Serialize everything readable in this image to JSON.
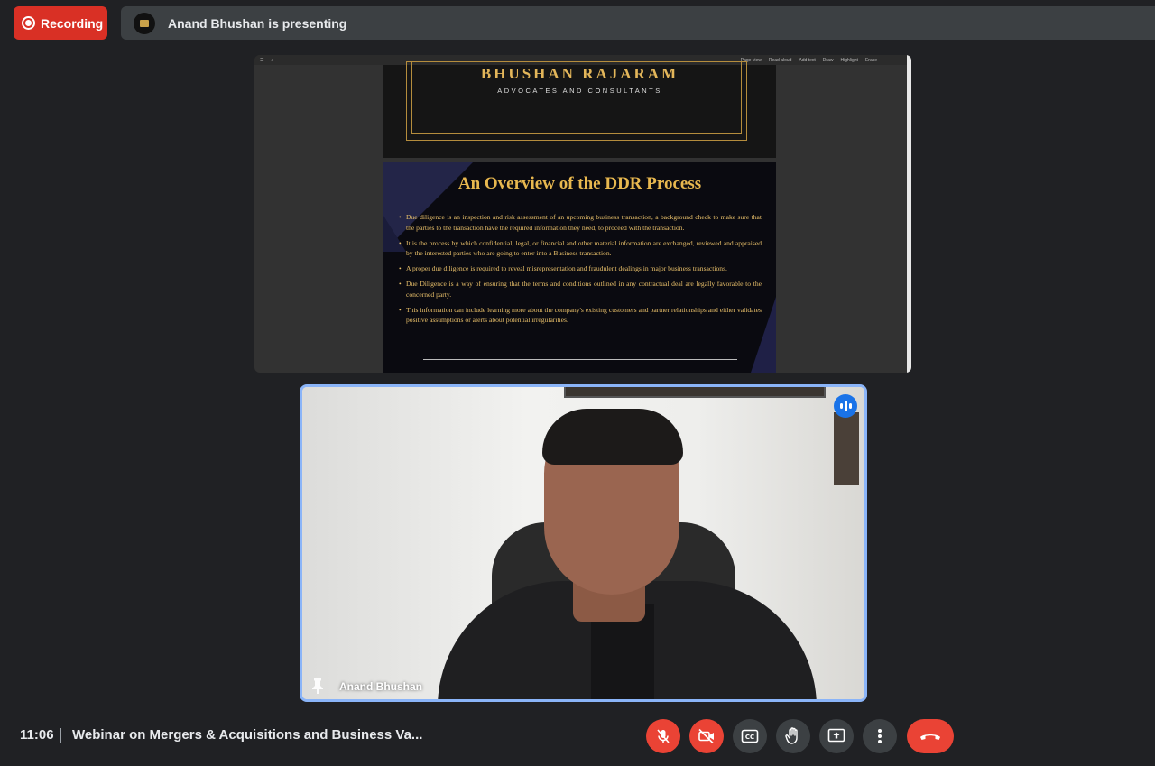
{
  "recording": {
    "label": "Recording"
  },
  "presenting": {
    "text": "Anand Bhushan is presenting"
  },
  "pdf_toolbar": {
    "items": [
      "Page view",
      "Read aloud",
      "Add text",
      "Draw",
      "Highlight",
      "Erase"
    ]
  },
  "slide_header": {
    "firm_name": "BHUSHAN RAJARAM",
    "firm_sub": "ADVOCATES AND CONSULTANTS"
  },
  "slide": {
    "title": "An Overview of the DDR Process",
    "bullets": [
      "Due diligence is an inspection and risk assessment of an upcoming business transaction, a background check to make sure that the parties to the transaction have the required information they need, to proceed with the transaction.",
      "It is the process by which confidential, legal, or financial and other material information are exchanged, reviewed and appraised by the interested parties who are going to enter into a Business transaction.",
      "A proper due diligence is required to reveal misrepresentation and fraudulent dealings in major business transactions.",
      "Due Diligence is a way of ensuring that the terms and conditions outlined in any contractual deal are legally favorable to the concerned party.",
      "This information can include learning more about the company's existing customers and partner relationships and either validates positive assumptions or alerts about potential irregularities."
    ]
  },
  "video_tile": {
    "participant_name": "Anand Bhushan"
  },
  "bottom_bar": {
    "time": "11:06",
    "meeting_title": "Webinar on Mergers & Acquisitions and Business Va..."
  },
  "colors": {
    "recording_red": "#d93025",
    "control_red": "#ea4335",
    "tile_border": "#8ab4f8",
    "slide_gold": "#e8b84f"
  }
}
